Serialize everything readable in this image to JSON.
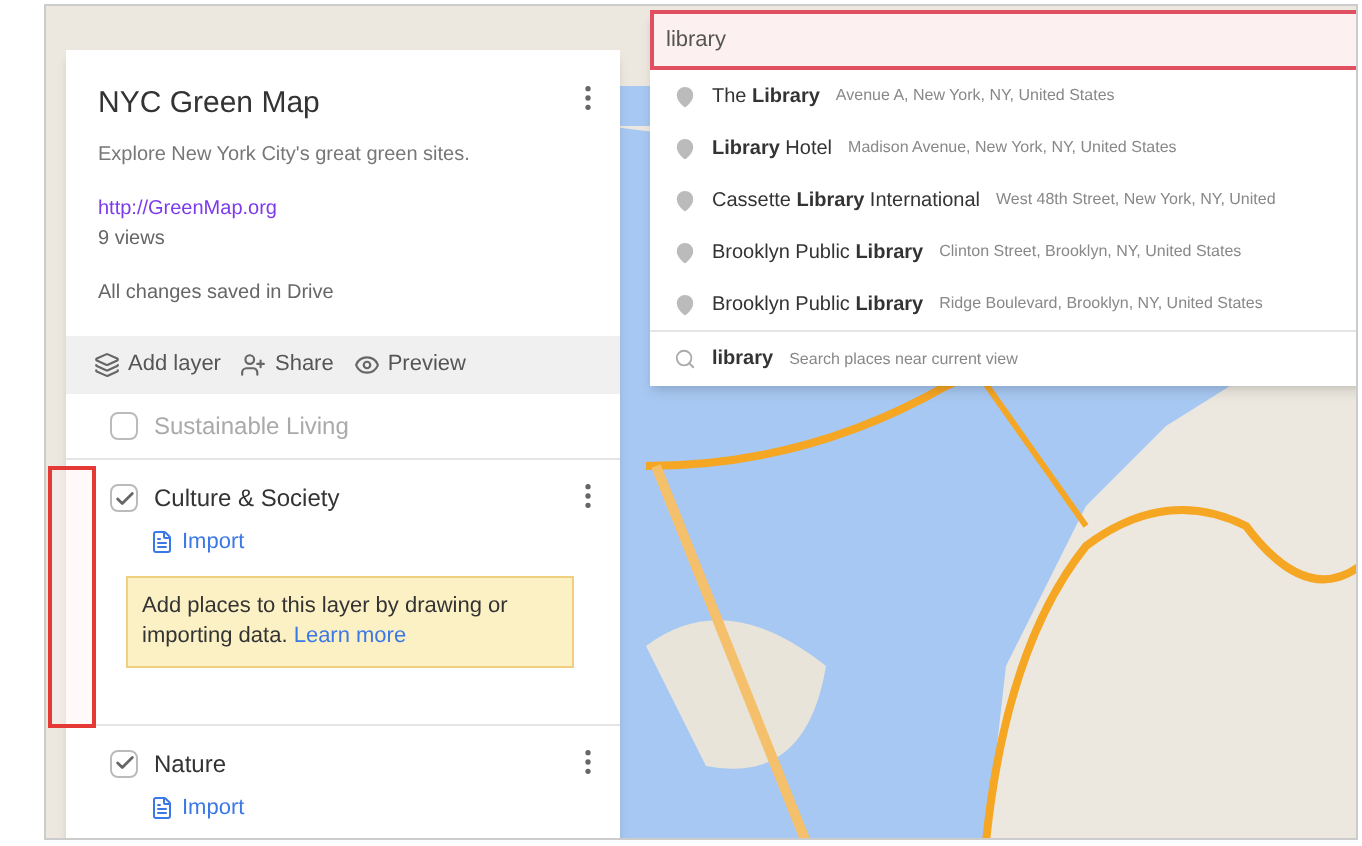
{
  "map_panel": {
    "title": "NYC Green Map",
    "description": "Explore New York City's great green sites.",
    "link": "http://GreenMap.org",
    "views": "9 views",
    "save_status": "All changes saved in Drive",
    "toolbar": [
      {
        "kind": "layer",
        "label": "Add layer"
      },
      {
        "kind": "share",
        "label": "Share"
      },
      {
        "kind": "preview",
        "label": "Preview"
      }
    ],
    "base_layer": {
      "label": "Sustainable Living",
      "checked": false
    },
    "layers": [
      {
        "name": "Culture & Society",
        "checked": true,
        "import": "Import",
        "tip": "Add places to this layer by drawing or importing data.",
        "tip_link": "Learn more"
      },
      {
        "name": "Nature",
        "checked": true,
        "import": "Import"
      }
    ]
  },
  "search": {
    "value": "library",
    "suggestions": [
      {
        "kind": "place",
        "name": "The **Library**",
        "address": "Avenue A, New York, NY, United States"
      },
      {
        "kind": "place",
        "name": "**Library** Hotel",
        "address": "Madison Avenue, New York, NY, United States"
      },
      {
        "kind": "place",
        "name": "Cassette **Library** International",
        "address": "West 48th Street, New York, NY, United"
      },
      {
        "kind": "place",
        "name": "Brooklyn Public **Library**",
        "address": "Clinton Street, Brooklyn, NY, United States"
      },
      {
        "kind": "place",
        "name": "Brooklyn Public **Library**",
        "address": "Ridge Boulevard, Brooklyn, NY, United States"
      },
      {
        "kind": "query",
        "name": "**library**",
        "address": "Search places near current view"
      }
    ]
  }
}
